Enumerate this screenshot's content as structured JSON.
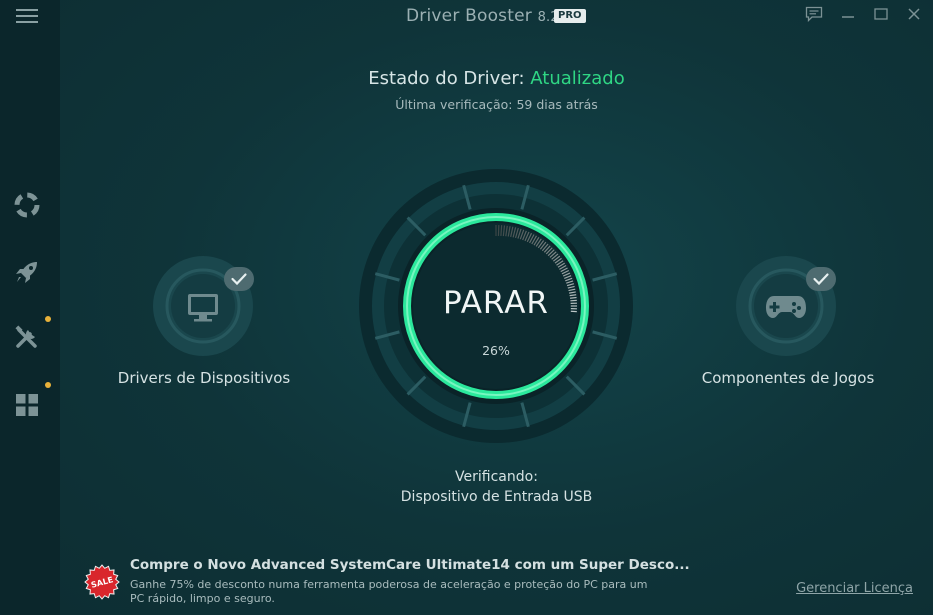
{
  "app": {
    "name": "Driver Booster",
    "version": "8.2",
    "badge": "PRO"
  },
  "status": {
    "label": "Estado do Driver:",
    "value": "Atualizado",
    "last_check": "Última verificação: 59 dias atrás"
  },
  "scan": {
    "button_label": "PARAR",
    "progress_percent": 26,
    "progress_text": "26%",
    "checking_label": "Verificando:",
    "checking_item": "Dispositivo de Entrada USB"
  },
  "categories": {
    "left": {
      "label": "Drivers de Dispositivos",
      "icon": "monitor-icon",
      "checked": true
    },
    "right": {
      "label": "Componentes de Jogos",
      "icon": "gamepad-icon",
      "checked": true
    }
  },
  "sidebar": {
    "items": [
      {
        "name": "menu",
        "icon": "hamburger-menu-icon"
      },
      {
        "name": "scan",
        "icon": "lifebuoy-icon"
      },
      {
        "name": "boost",
        "icon": "rocket-icon"
      },
      {
        "name": "tools",
        "icon": "tools-icon",
        "dot": true
      },
      {
        "name": "action-center",
        "icon": "grid-icon",
        "dot": true
      }
    ]
  },
  "window_controls": [
    "feedback-icon",
    "minimize-icon",
    "maximize-icon",
    "close-icon"
  ],
  "promo": {
    "badge": "SALE",
    "title": "Compre o Novo Advanced SystemCare Ultimate14 com um Super Desco...",
    "description": "Ganhe 75% de desconto numa ferramenta poderosa de aceleração e proteção do PC para um PC rápido, limpo e seguro."
  },
  "footer": {
    "license_link": "Gerenciar Licença"
  },
  "colors": {
    "accent_green": "#2fd684",
    "sidebar_bg": "#0b262b",
    "main_bg": "#0f3237",
    "notification_dot": "#e8b13a",
    "sale_red": "#d9262c"
  }
}
